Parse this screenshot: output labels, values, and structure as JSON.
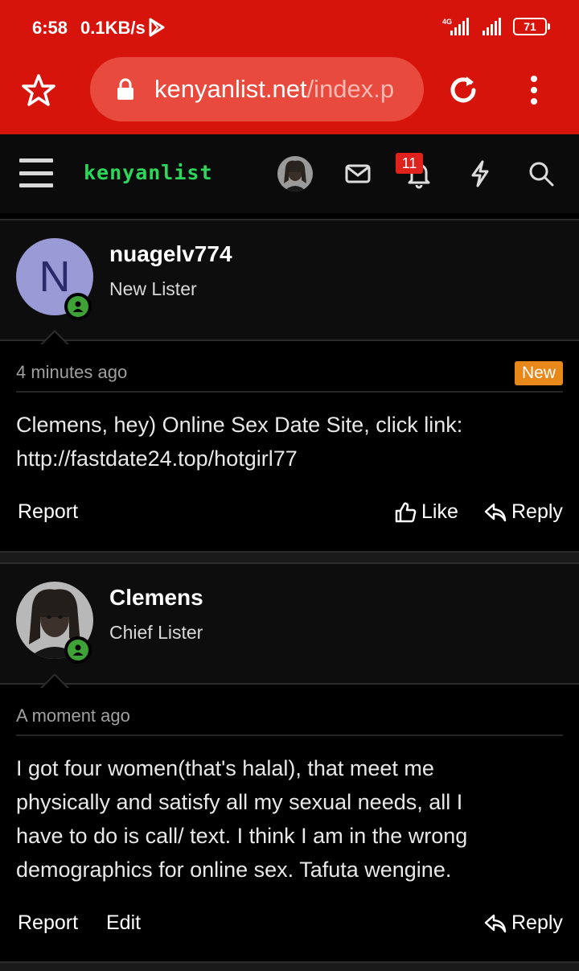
{
  "status_bar": {
    "time": "6:58",
    "speed": "0.1KB/s",
    "battery": "71"
  },
  "browser": {
    "url_host": "kenyanlist.net",
    "url_path": "/index.p"
  },
  "site": {
    "logo": "kenyanlist",
    "notification_count": "11"
  },
  "posts": [
    {
      "avatar_letter": "N",
      "username": "nuagelv774",
      "user_title": "New Lister",
      "time": "4 minutes ago",
      "badge": "New",
      "body_line1": "Clemens, hey) Online Sex Date Site, click link:",
      "body_line2": "http://fastdate24.top/hotgirl77",
      "actions": {
        "report": "Report",
        "like": "Like",
        "reply": "Reply"
      }
    },
    {
      "username": "Clemens",
      "user_title": "Chief Lister",
      "time": "A moment ago",
      "body_line1": "I got four women(that's halal), that meet me",
      "body_line2": "physically and satisfy all my sexual needs, all I",
      "body_line3": "have to do is call/ text. I think I am in the wrong",
      "body_line4": "demographics for online sex. Tafuta wengine.",
      "actions": {
        "report": "Report",
        "edit": "Edit",
        "reply": "Reply"
      }
    }
  ],
  "colors": {
    "chrome_red": "#d6140c",
    "logo_green": "#2bd85a",
    "new_badge": "#e8871a",
    "online_green": "#3ea236"
  }
}
